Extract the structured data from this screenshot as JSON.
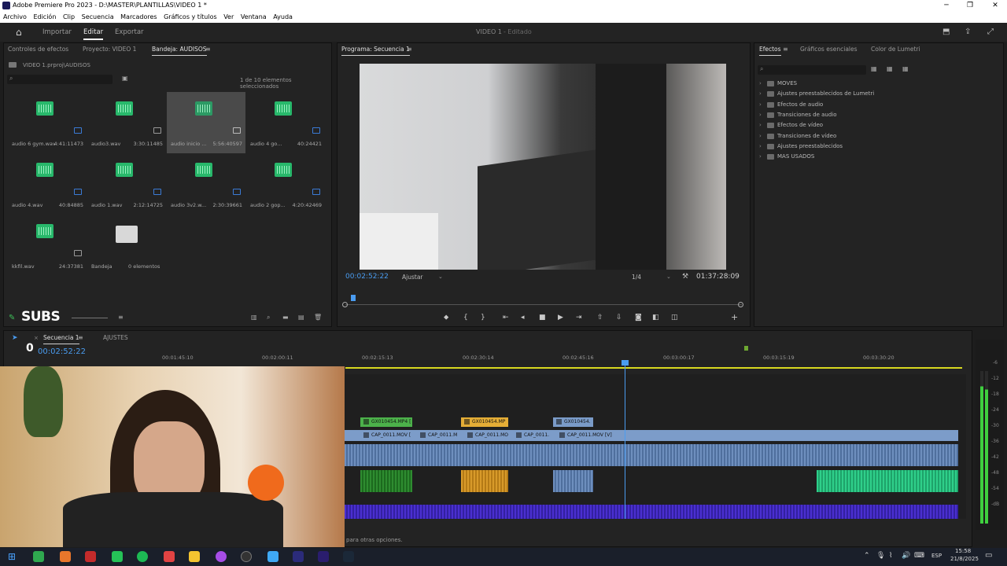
{
  "window": {
    "title": "Adobe Premiere Pro 2023 - D:\\MASTER\\PLANTILLAS\\VIDEO 1 *"
  },
  "menu": [
    "Archivo",
    "Edición",
    "Clip",
    "Secuencia",
    "Marcadores",
    "Gráficos y títulos",
    "Ver",
    "Ventana",
    "Ayuda"
  ],
  "workspace": {
    "tabs": [
      "Importar",
      "Editar",
      "Exportar"
    ],
    "active": "Editar",
    "project_title": "VIDEO 1",
    "project_status": "- Editado"
  },
  "left_panel": {
    "tabs": [
      "Controles de efectos",
      "Proyecto: VIDEO 1",
      "Bandeja: AUDISOS"
    ],
    "path": "VIDEO 1.prproj\\AUDISOS",
    "selection_info": "1 de 10 elementos seleccionados",
    "items": [
      {
        "name": "audio 6 gym.wav",
        "dur": "4:41:11473"
      },
      {
        "name": "audio3.wav",
        "dur": "3:30:11485"
      },
      {
        "name": "audio inicio ...",
        "dur": "5:56:40597",
        "selected": true
      },
      {
        "name": "audio 4 go...",
        "dur": "40:24421"
      },
      {
        "name": "audio 4.wav",
        "dur": "40:84885"
      },
      {
        "name": "audio 1.wav",
        "dur": "2:12:14725"
      },
      {
        "name": "audio 3v2.w...",
        "dur": "2:30:39661"
      },
      {
        "name": "audio 2 gop...",
        "dur": "4:20:42469"
      },
      {
        "name": "kkfil.wav",
        "dur": "24:37381"
      },
      {
        "name": "Bandeja",
        "dur": "0 elementos",
        "folder": true
      }
    ],
    "subs_label": "SUBS"
  },
  "program": {
    "tab": "Programa: Secuencia 1",
    "timecode": "00:02:52:22",
    "fit": "Ajustar",
    "quality": "1/4",
    "duration": "01:37:28:09"
  },
  "effects": {
    "tabs": [
      "Efectos",
      "Gráficos esenciales",
      "Color de Lumetri"
    ],
    "items": [
      "MOVES",
      "Ajustes preestablecidos de Lumetri",
      "Efectos de audio",
      "Transiciones de audio",
      "Efectos de vídeo",
      "Transiciones de vídeo",
      "Ajustes preestablecidos",
      "MAS USADOS"
    ]
  },
  "timeline": {
    "tabs": [
      "Secuencia 1",
      "AJUSTES"
    ],
    "timecode": "00:02:52:22",
    "ruler": [
      "00:01:45:10",
      "00:02:00:11",
      "00:02:15:13",
      "00:02:30:14",
      "00:02:45:16",
      "00:03:00:17",
      "00:03:15:19",
      "00:03:30:20"
    ],
    "v_clips": [
      "GX010454.MP4 [",
      "GX010454.MP",
      "GX010454."
    ],
    "a_clips": [
      "CAP_0011.MOV [",
      "CAP_0011.M",
      "CAP_0011.MO",
      "CAP_0011.",
      "CAP_0011.MOV [V]"
    ],
    "status": "para otras opciones.",
    "meter_labels": [
      "-6",
      "-12",
      "-18",
      "-24",
      "-30",
      "-36",
      "-42",
      "-48",
      "-54",
      "-dB"
    ]
  },
  "taskbar": {
    "lang": "ESP",
    "time": "15:58",
    "date": "21/8/2025"
  }
}
